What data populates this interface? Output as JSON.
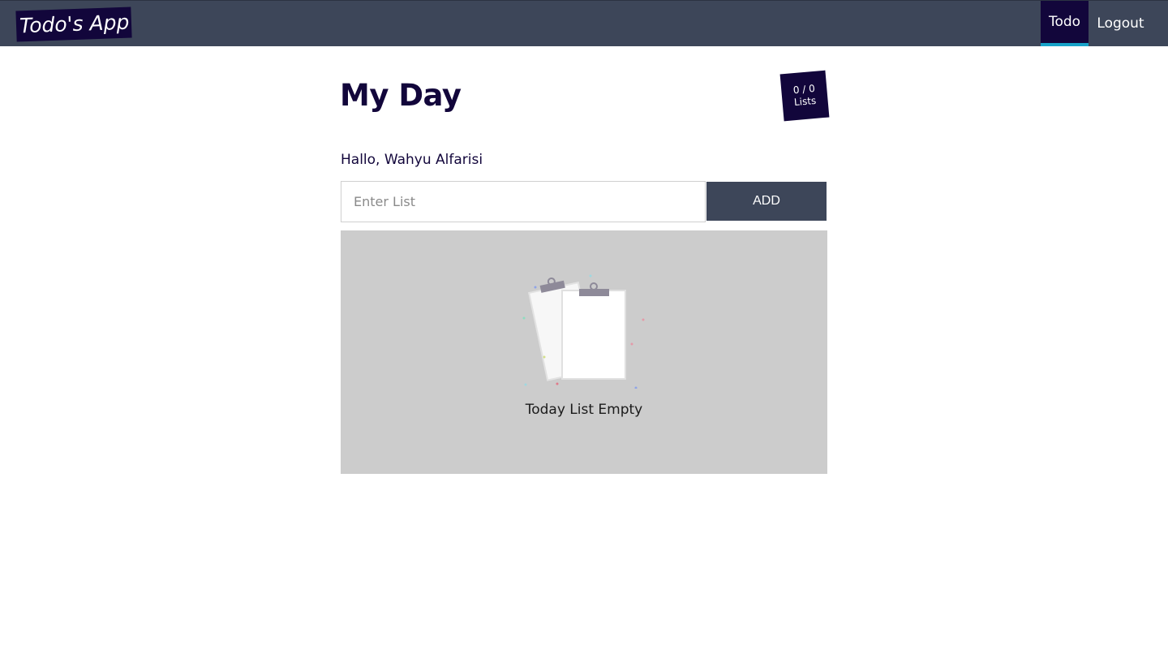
{
  "navbar": {
    "brand": "Todo's App",
    "links": [
      {
        "label": "Todo",
        "active": true
      },
      {
        "label": "Logout",
        "active": false
      }
    ]
  },
  "main": {
    "title": "My Day",
    "counter": {
      "value": "0 / 0",
      "unit": "Lists"
    },
    "greeting": "Hallo, Wahyu Alfarisi",
    "input": {
      "placeholder": "Enter List",
      "value": ""
    },
    "add_label": "ADD",
    "empty": {
      "icon": "empty-clipboard-icon",
      "text": "Today List Empty"
    }
  },
  "colors": {
    "navbar_bg": "#3d4659",
    "brand_bg": "#12063b",
    "active_underline": "#17a2c8",
    "panel_bg": "#cccccc"
  }
}
